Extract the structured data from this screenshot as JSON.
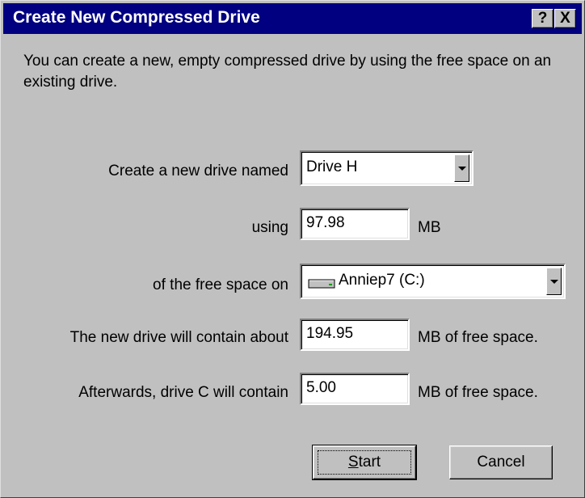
{
  "window": {
    "title": "Create New Compressed Drive",
    "help_button": "?",
    "close_button": "X"
  },
  "intro": "You can create a new, empty compressed drive by using the free space on an existing drive.",
  "form": {
    "drive_name": {
      "label": "Create a new drive named",
      "value": "Drive H"
    },
    "size": {
      "label": "using",
      "value": "97.98",
      "unit": "MB"
    },
    "source": {
      "label": "of the free space on",
      "value": "Anniep7 (C:)",
      "icon": "hard-drive-icon"
    },
    "new_drive": {
      "label": "The new drive will contain about",
      "value": "194.95",
      "unit": "MB of free space."
    },
    "afterwards": {
      "label": "Afterwards, drive C will contain",
      "value": "5.00",
      "unit": "MB of free space."
    }
  },
  "buttons": {
    "start": "Start",
    "cancel": "Cancel"
  },
  "colors": {
    "titlebar": "#000080",
    "face": "#c0c0c0"
  }
}
